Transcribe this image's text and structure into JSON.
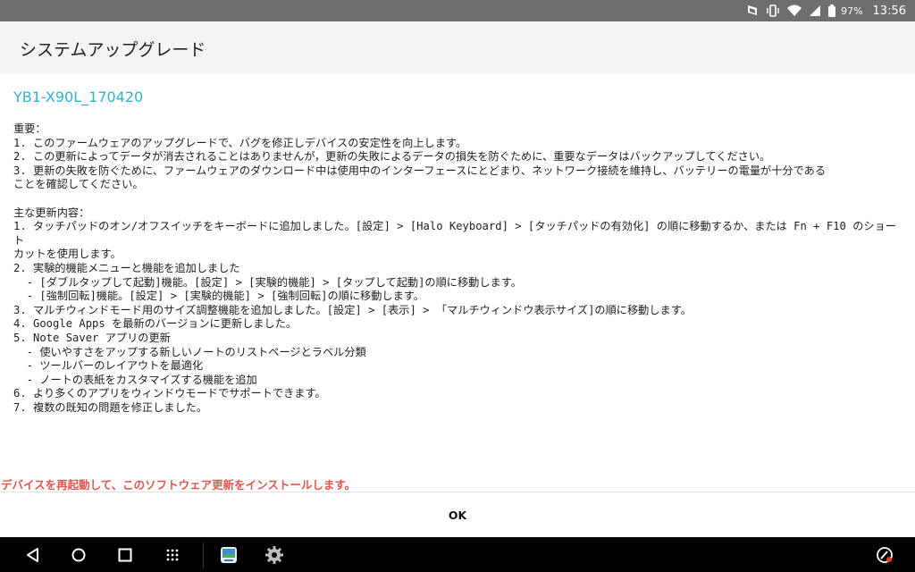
{
  "status_bar": {
    "icons": [
      "lenovo-logo-icon",
      "vibrate-icon",
      "wifi-icon",
      "cell-signal-icon",
      "battery-icon"
    ],
    "battery": "97%",
    "time": "13:56"
  },
  "title": "システムアップグレード",
  "version": "YB1-X90L_170420",
  "notes": "重要：\n1. このファームウェアのアップグレードで、バグを修正しデバイスの安定性を向上します。\n2. この更新によってデータが消去されることはありませんが，更新の失敗によるデータの損失を防ぐために、重要なデータはバックアップしてください。\n3. 更新の失敗を防ぐために、ファームウェアのダウンロード中は使用中のインターフェースにとどまり、ネットワーク接続を維持し、バッテリーの電量が十分である\nことを確認してください。\n\n主な更新内容：\n1. タッチパッドのオン/オフスイッチをキーボードに追加しました。[設定] > [Halo Keyboard] > [タッチパッドの有効化] の順に移動するか、または Fn + F10 のショート\nカットを使用します。\n2. 実験的機能メニューと機能を追加しました\n  - [ダブルタップして起動]機能。[設定] > [実験的機能] > [タップして起動]の順に移動します。\n  - [強制回転]機能。[設定] > [実験的機能] > [強制回転]の順に移動します。\n3. マルチウィンドモード用のサイズ調整機能を追加しました。[設定] > [表示] > 「マルチウィンドウ表示サイズ]の順に移動します。\n4. Google Apps を最新のバージョンに更新しました。\n5. Note Saver アプリの更新\n  - 使いやすさをアップする新しいノートのリストページとラベル分類\n  - ツールバーのレイアウトを最適化\n  - ノートの表紙をカスタマイズする機能を追加\n6. より多くのアプリをウィンドウモードでサポートできます。\n7. 複数の既知の問題を修正しました。",
  "restart_note": "デバイスを再起動して、このソフトウェア更新をインストールします。",
  "ok_label": "OK",
  "nav_bar": {
    "buttons": [
      "back-icon",
      "home-icon",
      "recents-icon",
      "app-drawer-icon",
      "gallery-app-icon",
      "settings-icon",
      "eye-care-icon"
    ]
  },
  "colors": {
    "status_bar": "#6e6e6e",
    "title_bar": "#f4f4f4",
    "version_accent": "#2fb2d0",
    "warning_text": "#e2574c",
    "nav_bar": "#000000"
  }
}
